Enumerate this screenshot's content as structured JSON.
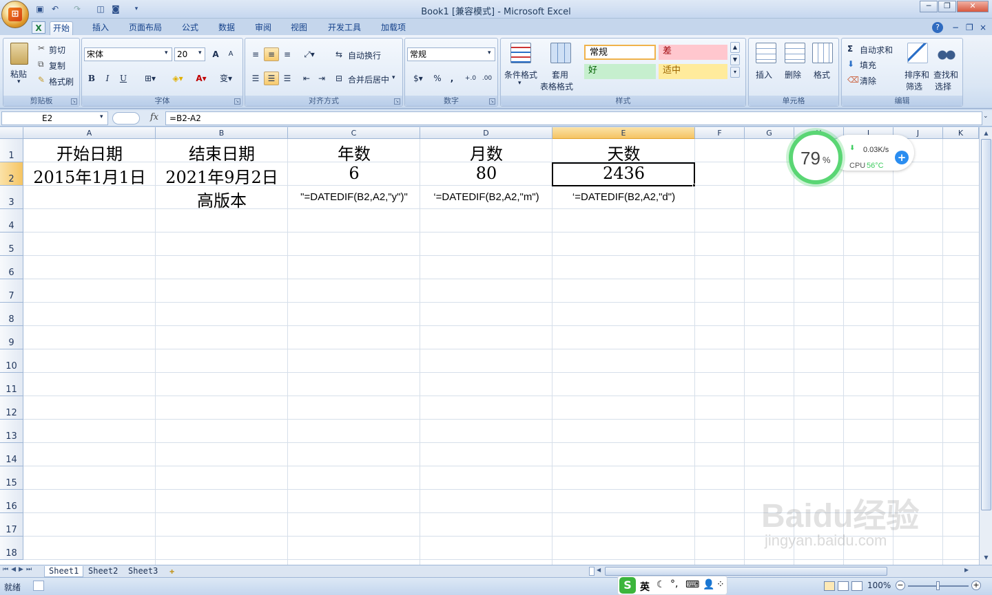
{
  "window": {
    "title": "Book1  [兼容模式] - Microsoft Excel",
    "minimize": "─",
    "restore": "❐",
    "close": "✕"
  },
  "tabs": [
    "开始",
    "插入",
    "页面布局",
    "公式",
    "数据",
    "审阅",
    "视图",
    "开发工具",
    "加载项"
  ],
  "ribbon": {
    "clipboard": {
      "title": "剪贴板",
      "paste": "粘贴",
      "cut": "剪切",
      "copy": "复制",
      "format_painter": "格式刷"
    },
    "font": {
      "title": "字体",
      "name": "宋体",
      "size": "20",
      "grow": "A",
      "shrink": "A",
      "bold": "B",
      "italic": "I",
      "underline": "U"
    },
    "alignment": {
      "title": "对齐方式",
      "wrap": "自动换行",
      "merge": "合并后居中"
    },
    "number": {
      "title": "数字",
      "format": "常规",
      "percent": "%",
      "comma": ","
    },
    "styles": {
      "title": "样式",
      "conditional": "条件格式",
      "table_line1": "套用",
      "table_line2": "表格格式",
      "normal": "常规",
      "bad": "差",
      "good": "好",
      "neutral": "适中"
    },
    "cells": {
      "title": "单元格",
      "insert": "插入",
      "delete": "删除",
      "format": "格式"
    },
    "editing": {
      "title": "编辑",
      "autosum": "自动求和",
      "fill": "填充",
      "clear": "清除",
      "sort_line1": "排序和",
      "sort_line2": "筛选",
      "find_line1": "查找和",
      "find_line2": "选择"
    }
  },
  "formula_bar": {
    "name_box": "E2",
    "fx": "fx",
    "formula": "=B2-A2"
  },
  "grid": {
    "columns": [
      "A",
      "B",
      "C",
      "D",
      "E",
      "F",
      "G",
      "H",
      "I",
      "J",
      "K"
    ],
    "rows": [
      "1",
      "2",
      "3",
      "4",
      "5",
      "6",
      "7",
      "8",
      "9",
      "10",
      "11",
      "12",
      "13",
      "14",
      "15",
      "16",
      "17",
      "18"
    ],
    "active_cell": "E2",
    "cells": {
      "A1": "开始日期",
      "B1": "结束日期",
      "C1": "年数",
      "D1": "月数",
      "E1": "天数",
      "A2": "2015年1月1日",
      "B2": "2021年9月2日",
      "C2": "6",
      "D2": "80",
      "E2": "2436",
      "B3": "高版本",
      "C3": "\"=DATEDIF(B2,A2,\"y\")\"",
      "D3": "‘=DATEDIF(B2,A2,\"m\")",
      "E3": "‘=DATEDIF(B2,A2,\"d\")"
    }
  },
  "sheets": [
    "Sheet1",
    "Sheet2",
    "Sheet3"
  ],
  "status": {
    "ready": "就绪",
    "zoom": "100%",
    "ime": "英"
  },
  "widget": {
    "percent": "79",
    "percent_sign": "%",
    "net": "0.03K/s",
    "cpu_label": "CPU",
    "cpu_temp": "56°C"
  },
  "watermark": {
    "brand": "Baidu经验",
    "url": "jingyan.baidu.com"
  },
  "colors": {
    "accent": "#15428b",
    "selected_header": "#f5c463",
    "good_bg": "#c6efce",
    "bad_bg": "#ffc7ce",
    "neutral_bg": "#ffeb9c",
    "widget_green": "#3ccc5e"
  }
}
